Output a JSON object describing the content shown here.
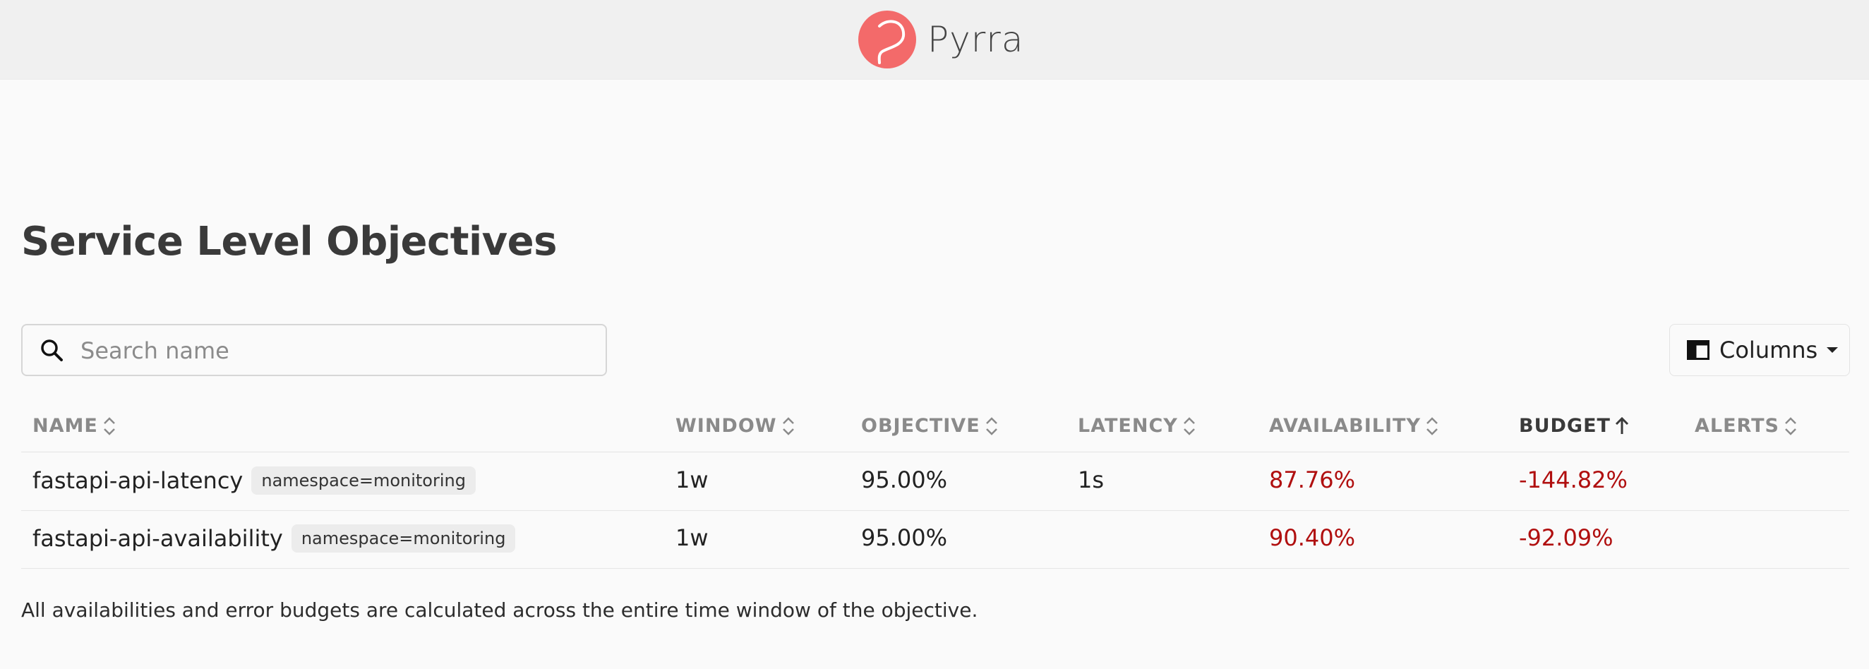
{
  "app": {
    "name": "Pyrra",
    "brand_color": "#f36a6a"
  },
  "page": {
    "title": "Service Level Objectives",
    "footnote": "All availabilities and error budgets are calculated across the entire time window of the objective."
  },
  "search": {
    "placeholder": "Search name",
    "value": "",
    "icon": "search-icon"
  },
  "columns_button": {
    "label": "Columns",
    "icon": "columns-icon"
  },
  "table": {
    "columns": [
      {
        "key": "name",
        "label": "NAME",
        "sort": "none"
      },
      {
        "key": "window",
        "label": "WINDOW",
        "sort": "none"
      },
      {
        "key": "objective",
        "label": "OBJECTIVE",
        "sort": "none"
      },
      {
        "key": "latency",
        "label": "LATENCY",
        "sort": "none"
      },
      {
        "key": "availability",
        "label": "AVAILABILITY",
        "sort": "none"
      },
      {
        "key": "budget",
        "label": "BUDGET",
        "sort": "ascending"
      },
      {
        "key": "alerts",
        "label": "ALERTS",
        "sort": "none"
      }
    ],
    "rows": [
      {
        "name": "fastapi-api-latency",
        "label": "namespace=monitoring",
        "window": "1w",
        "objective": "95.00%",
        "latency": "1s",
        "availability": "87.76%",
        "budget": "-144.82%",
        "alerts": ""
      },
      {
        "name": "fastapi-api-availability",
        "label": "namespace=monitoring",
        "window": "1w",
        "objective": "95.00%",
        "latency": "",
        "availability": "90.40%",
        "budget": "-92.09%",
        "alerts": ""
      }
    ],
    "negative_color": "#b00f0f"
  }
}
